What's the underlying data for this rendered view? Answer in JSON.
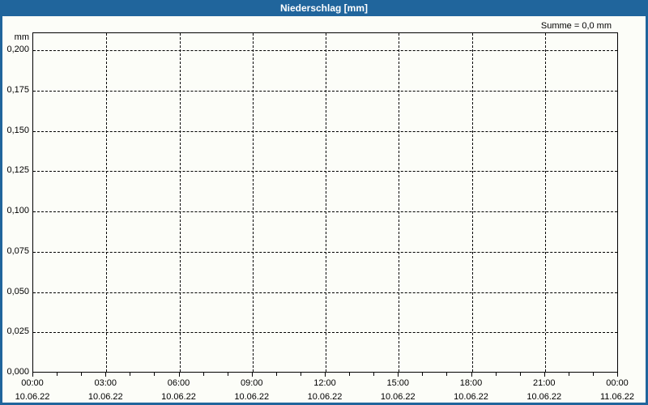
{
  "window": {
    "title": "Niederschlag [mm]",
    "summe_label": "Summe = 0,0 mm",
    "colors": {
      "titlebar": "#20659c",
      "border": "#20659c",
      "background": "#fcfdf8",
      "axis": "#000000",
      "grid": "#000000",
      "title_text": "#ffffff",
      "label_text": "#000000"
    }
  },
  "chart_data": {
    "type": "line",
    "title": "Niederschlag [mm]",
    "ylabel": "mm",
    "annotation": "Summe = 0,0 mm",
    "ylim": [
      0.0,
      0.21
    ],
    "grid": {
      "style": "dashed",
      "horizontal": true,
      "vertical": true
    },
    "legend_position": "none",
    "y_ticks": [
      {
        "label": "0,200",
        "value": 0.2
      },
      {
        "label": "0,175",
        "value": 0.175
      },
      {
        "label": "0,150",
        "value": 0.15
      },
      {
        "label": "0,125",
        "value": 0.125
      },
      {
        "label": "0,100",
        "value": 0.1
      },
      {
        "label": "0,075",
        "value": 0.075
      },
      {
        "label": "0,050",
        "value": 0.05
      },
      {
        "label": "0,025",
        "value": 0.025
      },
      {
        "label": "0,000",
        "value": 0.0
      }
    ],
    "x_ticks": [
      {
        "time": "00:00",
        "date": "10.06.22"
      },
      {
        "time": "03:00",
        "date": "10.06.22"
      },
      {
        "time": "06:00",
        "date": "10.06.22"
      },
      {
        "time": "09:00",
        "date": "10.06.22"
      },
      {
        "time": "12:00",
        "date": "10.06.22"
      },
      {
        "time": "15:00",
        "date": "10.06.22"
      },
      {
        "time": "18:00",
        "date": "10.06.22"
      },
      {
        "time": "21:00",
        "date": "10.06.22"
      },
      {
        "time": "00:00",
        "date": "11.06.22"
      }
    ],
    "x_minor_ticks_interval_hours": 1,
    "x_major_tick_interval_hours": 3,
    "series": [
      {
        "name": "Niederschlag",
        "sum_mm": 0.0,
        "values": []
      }
    ]
  }
}
